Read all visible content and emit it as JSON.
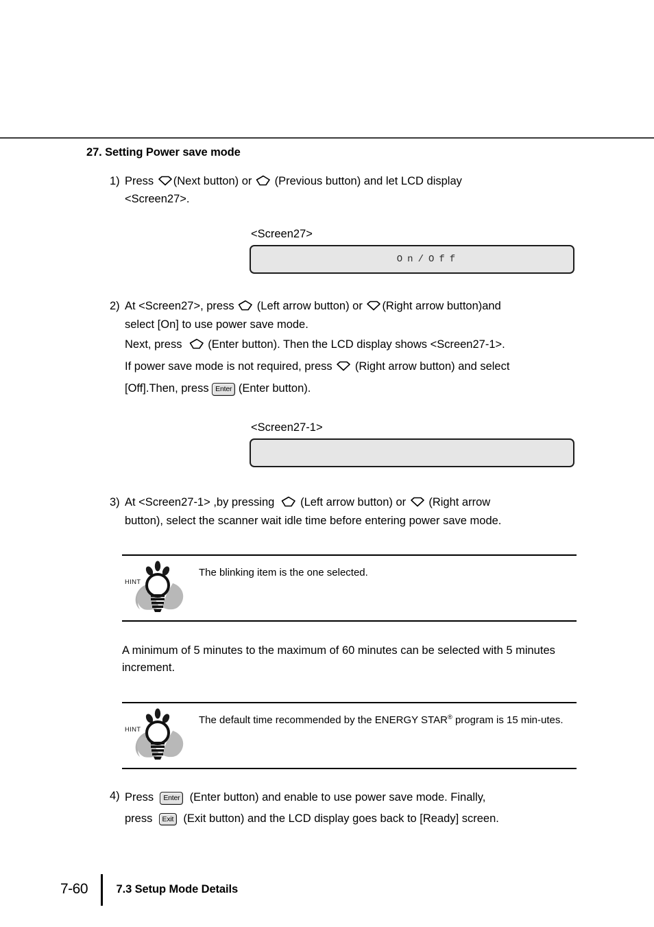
{
  "document": {
    "heading": "27. Setting Power save mode"
  },
  "steps": [
    {
      "number": "1)",
      "lines": [
        {
          "parts": [
            {
              "type": "text",
              "value": "Press "
            },
            {
              "type": "glyph",
              "icon": "next-button-diamond"
            },
            {
              "type": "text",
              "value": "(Next button) or "
            },
            {
              "type": "glyph",
              "icon": "previous-button-diamond"
            },
            {
              "type": "text",
              "value": " (Previous button) and let LCD display"
            }
          ]
        },
        {
          "parts": [
            {
              "type": "text",
              "value": "<Screen27>."
            }
          ]
        }
      ]
    },
    {
      "number": "2)",
      "lines": [
        {
          "parts": [
            {
              "type": "text",
              "value": "At <Screen27>, press "
            },
            {
              "type": "glyph",
              "icon": "left-arrow-button-diamond"
            },
            {
              "type": "text",
              "value": " (Left arrow button) or "
            },
            {
              "type": "glyph",
              "icon": "right-arrow-button-diamond"
            },
            {
              "type": "text",
              "value": "(Right arrow button)and"
            }
          ]
        },
        {
          "parts": [
            {
              "type": "text",
              "value": "select [On] to use power save mode."
            }
          ]
        },
        {
          "parts": [
            {
              "type": "text",
              "value": "Next, press "
            },
            {
              "type": "glyph",
              "icon": "enter-button-diamond"
            },
            {
              "type": "text",
              "value": " (Enter button). Then the LCD display shows <Screen27-1>."
            }
          ]
        },
        {
          "parts": [
            {
              "type": "text",
              "value": "If power save mode is not required, press "
            },
            {
              "type": "glyph",
              "icon": "right-arrow-button-diamond"
            },
            {
              "type": "text",
              "value": " (Right arrow button) and select"
            }
          ]
        },
        {
          "parts": [
            {
              "type": "text",
              "value": "[Off].Then, press "
            },
            {
              "type": "key",
              "label": "Enter"
            },
            {
              "type": "text",
              "value": " (Enter button)."
            }
          ]
        }
      ]
    },
    {
      "number": "3)",
      "lines": [
        {
          "parts": [
            {
              "type": "text",
              "value": "At <Screen27-1> ,by pressing "
            },
            {
              "type": "glyph",
              "icon": "left-arrow-button-diamond"
            },
            {
              "type": "text",
              "value": " (Left arrow button) or "
            },
            {
              "type": "glyph",
              "icon": "right-arrow-button-diamond"
            },
            {
              "type": "text",
              "value": " (Right arrow"
            }
          ]
        },
        {
          "parts": [
            {
              "type": "text",
              "value": "button), select the scanner wait idle time before entering power save mode."
            }
          ]
        }
      ]
    },
    {
      "number": "4)",
      "lines": [
        {
          "parts": [
            {
              "type": "text",
              "value": "Press "
            },
            {
              "type": "key",
              "label": "Enter"
            },
            {
              "type": "text",
              "value": " (Enter button) and enable to use power save mode. Finally,"
            }
          ]
        },
        {
          "parts": [
            {
              "type": "text",
              "value": "press "
            },
            {
              "type": "key",
              "label": "Exit"
            },
            {
              "type": "text",
              "value": " (Exit button) and the LCD display goes back to [Ready] screen."
            }
          ]
        }
      ]
    }
  ],
  "screens": [
    {
      "caption": "<Screen27>",
      "lcd_text": "On/Off",
      "empty": false
    },
    {
      "caption": "<Screen27-1>",
      "lcd_text": "",
      "empty": true
    }
  ],
  "hints": [
    {
      "label": "HINT",
      "icon": "lightbulb-icon",
      "text_parts": [
        {
          "type": "text",
          "value": "The blinking item is the one selected."
        }
      ]
    },
    {
      "label": "HINT",
      "icon": "lightbulb-icon",
      "text_parts": [
        {
          "type": "text",
          "value": "The default time recommended by the ENERGY STAR"
        },
        {
          "type": "sup",
          "value": "®"
        },
        {
          "type": "text",
          "value": " program is 15 min-utes."
        }
      ]
    }
  ],
  "paragraph": "A minimum of 5 minutes to the maximum of 60 minutes can be selected with 5 minutes increment.",
  "footer": {
    "page_number": "7-60",
    "section": "7.3 Setup Mode Details"
  },
  "colors": {
    "text": "#000000",
    "rule": "#3a3a3a",
    "lcd_fill": "#e6e6e6",
    "lcd_border": "#1c1c1c",
    "key_fill": "#e2e2e2",
    "icon_shadow": "#a8a8a8"
  }
}
